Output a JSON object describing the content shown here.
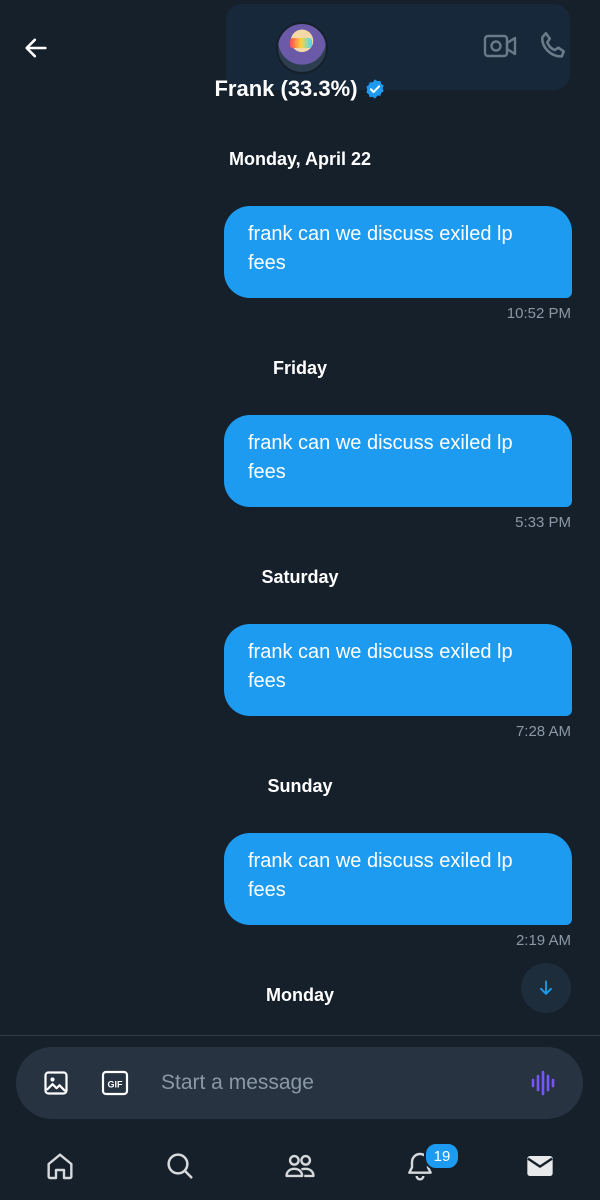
{
  "header": {
    "title": "Frank (33.3%)",
    "back_icon": "arrow-left-icon",
    "verified_icon": "verified-badge-icon",
    "video_icon": "video-camera-icon",
    "phone_icon": "phone-icon"
  },
  "conversation": [
    {
      "day": "Monday, April 22",
      "text": "frank can we discuss exiled lp fees",
      "time": "10:52 PM"
    },
    {
      "day": "Friday",
      "text": "frank can we discuss exiled lp fees",
      "time": "5:33 PM"
    },
    {
      "day": "Saturday",
      "text": "frank can we discuss exiled lp fees",
      "time": "7:28 AM"
    },
    {
      "day": "Sunday",
      "text": "frank can we discuss exiled lp fees",
      "time": "2:19 AM"
    },
    {
      "day": "Monday"
    }
  ],
  "composer": {
    "placeholder": "Start a message",
    "gif_label": "GIF",
    "image_icon": "image-icon",
    "voice_icon": "voice-wave-icon"
  },
  "nav": {
    "items": [
      "home-icon",
      "search-icon",
      "communities-icon",
      "notifications-icon",
      "messages-icon"
    ],
    "notification_count": "19"
  },
  "colors": {
    "background": "#15202b",
    "bubble": "#1d9bf0",
    "timestamp": "#8b98a5",
    "accent_voice": "#7856ff"
  }
}
